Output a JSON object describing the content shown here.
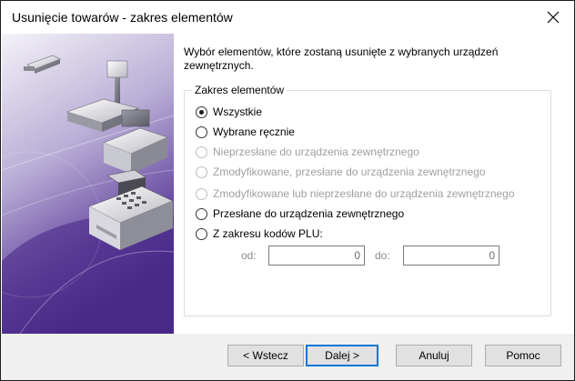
{
  "window": {
    "title": "Usunięcie towarów - zakres elementów"
  },
  "intro": {
    "text": "Wybór elementów, które zostaną usunięte z wybranych urządzeń zewnętrznych."
  },
  "group": {
    "legend": "Zakres elementów",
    "options": [
      {
        "label": "Wszystkie",
        "checked": true,
        "enabled": true
      },
      {
        "label": "Wybrane ręcznie",
        "checked": false,
        "enabled": true
      },
      {
        "label": "Nieprzesłane do urządzenia zewnętrznego",
        "checked": false,
        "enabled": false
      },
      {
        "label": "Zmodyfikowane, przesłane do urządzenia zewnętrznego",
        "checked": false,
        "enabled": false
      },
      {
        "label": "Zmodyfikowane lub nieprzesłane do urządzenia zewnętrznego",
        "checked": false,
        "enabled": false
      },
      {
        "label": "Przesłane do urządzenia zewnętrznego",
        "checked": false,
        "enabled": true
      },
      {
        "label": "Z zakresu kodów PLU:",
        "checked": false,
        "enabled": true
      }
    ],
    "plu": {
      "from_label": "od:",
      "from_value": "0",
      "to_label": "do:",
      "to_value": "0"
    }
  },
  "buttons": {
    "back": "< Wstecz",
    "next": "Dalej >",
    "cancel": "Anuluj",
    "help": "Pomoc"
  },
  "colors": {
    "side_panel_dark": "#4a2a88",
    "side_panel_light": "#e8e4f2",
    "accent_focus": "#0078d7",
    "disabled_text": "#a0a0a0"
  },
  "icons": {
    "close": "close-icon",
    "devices": "cash-register-illustration"
  }
}
